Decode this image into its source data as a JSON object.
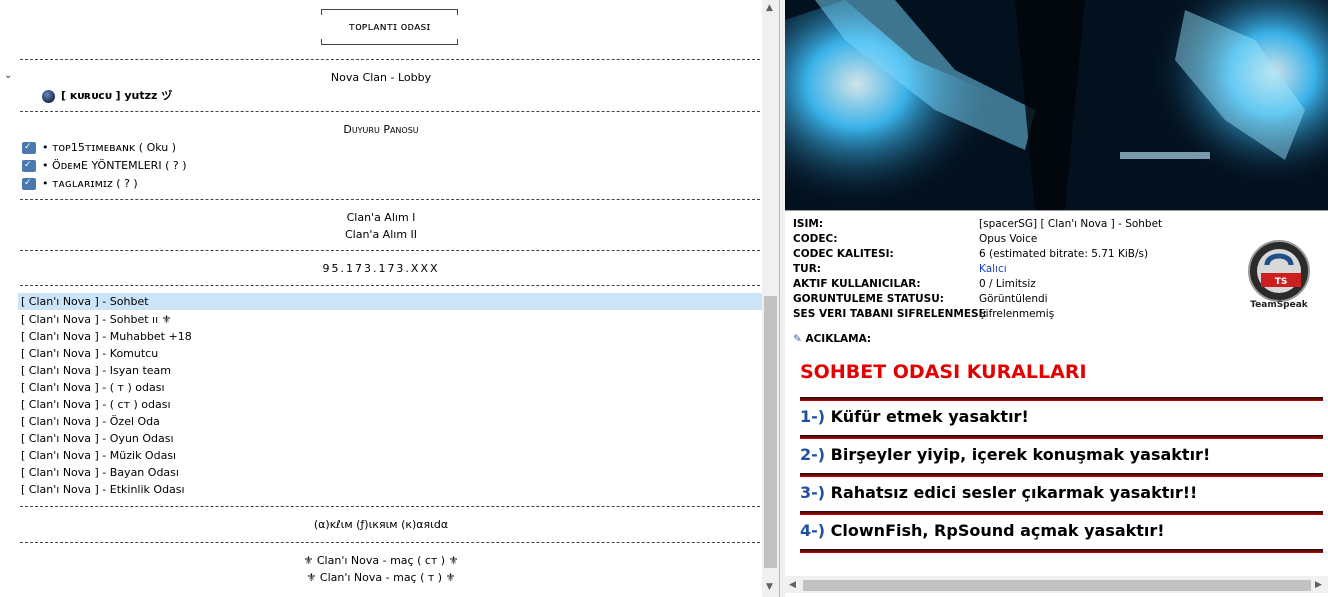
{
  "tree": {
    "top_box": "ᴛᴏᴘʟᴀɴᴛɪ ᴏᴅᴀsɪ",
    "lobby": "Nova Clan - Lobby",
    "kurucu_client": "[ ᴋᴜʀᴜᴄᴜ ] yutzz ヅ",
    "duyuru_title": "Duyuru Panosu",
    "duyuru_items": [
      "• ᴛᴏᴘ15ᴛɪᴍᴇʙᴀɴᴋ ( Oku )",
      "• ÖᴅᴇᴍE YÖNTEMLERI ( ? )",
      "• ᴛᴀɢʟᴀʀɪᴍɪᴢ ( ? )"
    ],
    "alim_1": "Clan'a Alım I",
    "alim_2": "Clan'a Alım II",
    "ip": "95.173.173.XXX",
    "channels": [
      "[ Clan'ı Nova ] - Sohbet",
      "[ Clan'ı Nova ] - Sohbet ıı ⚜",
      "[ Clan'ı Nova ] - Muhabbet +18",
      "[ Clan'ı Nova ] - Komutcu",
      "[ Clan'ı Nova ] - Isyan team",
      "[ Clan'ı Nova ] - ( т ) odası",
      "[ Clan'ı Nova ] - ( ст ) odası",
      "[ Clan'ı Nova ] - Özel Oda",
      "[ Clan'ı Nova ] - Oyun Odası",
      "[ Clan'ı Nova ] - Müzik Odası",
      "[ Clan'ı Nova ] - Bayan Odası",
      "[ Clan'ı Nova ] - Etkinlik Odası"
    ],
    "akim": "(α)ĸℓιм (ƒ)ιкяιм (к)αяιdα",
    "mac_1": "⚜ Clan'ı Nova - maç ( ст ) ⚜",
    "mac_2": "⚜ Clan'ı Nova - maç ( т ) ⚜"
  },
  "info": {
    "rows": [
      {
        "key": "ISIM:",
        "value": "[spacerSG] [ Clan'ı Nova ] - Sohbet"
      },
      {
        "key": "CODEC:",
        "value": "Opus Voice"
      },
      {
        "key": "CODEC KALITESI:",
        "value": "6 (estimated bitrate: 5.71 KiB/s)"
      },
      {
        "key": "TUR:",
        "value": "Kalıcı"
      },
      {
        "key": "AKTIF KULLANICILAR:",
        "value": "0 / Limitsiz"
      },
      {
        "key": "GORUNTULEME STATUSU:",
        "value": "Görüntülendi"
      },
      {
        "key": "SES VERI TABANI SIFRELENMESI:",
        "value": "Şifrelenmemiş"
      }
    ],
    "desc_label": "ACIKLAMA:",
    "rules_title": "SOHBET ODASI KURALLARI",
    "rules": [
      {
        "num": "1-)",
        "text": "Küfür etmek yasaktır!"
      },
      {
        "num": "2-)",
        "text": "Birşeyler yiyip, içerek konuşmak yasaktır!"
      },
      {
        "num": "3-)",
        "text": "Rahatsız edici sesler çıkarmak yasaktır!!"
      },
      {
        "num": "4-)",
        "text": "ClownFish, RpSound açmak yasaktır!"
      }
    ],
    "logo_text": "TeamSpeak",
    "logo_badge": "TS"
  },
  "colors": {
    "rules_title": "#e30000",
    "rule_num": "#1f4fa0",
    "selection": "#cce4f7",
    "link": "#1a3fbf"
  }
}
